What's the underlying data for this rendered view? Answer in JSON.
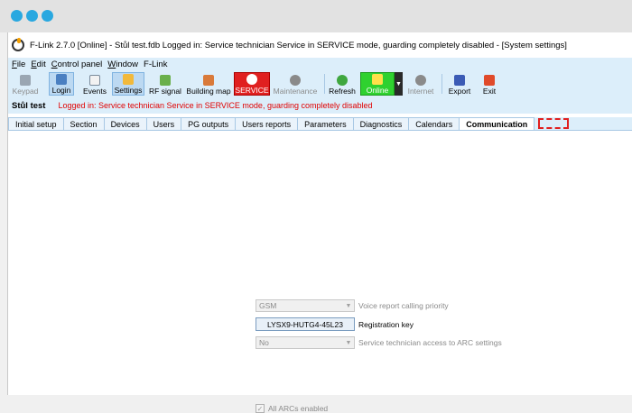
{
  "window": {
    "title": "F-Link 2.7.0 [Online] - Stůl test.fdb Logged in: Service technician Service in SERVICE mode, guarding completely disabled - [System settings]"
  },
  "menu": [
    {
      "accel": "F",
      "rest": "ile"
    },
    {
      "accel": "E",
      "rest": "dit"
    },
    {
      "accel": "C",
      "rest": "ontrol panel"
    },
    {
      "accel": "W",
      "rest": "indow"
    },
    {
      "accel": "",
      "rest": "F-Link"
    }
  ],
  "toolbar": {
    "keypad": "Keypad",
    "login": "Login",
    "events": "Events",
    "settings": "Settings",
    "rf_signal": "RF signal",
    "building_map": "Building map",
    "service": "SERVICE",
    "maintenance": "Maintenance",
    "refresh": "Refresh",
    "online": "Online",
    "internet": "Internet",
    "export": "Export",
    "exit": "Exit",
    "colors": {
      "service": "#e02020",
      "online": "#2fd12f"
    }
  },
  "status": {
    "device": "Stůl test",
    "message": "Logged in: Service technician Service in SERVICE mode, guarding completely disabled"
  },
  "tabs": [
    "Initial setup",
    "Section",
    "Devices",
    "Users",
    "PG outputs",
    "Users reports",
    "Parameters",
    "Diagnostics",
    "Calendars",
    "Communication"
  ],
  "active_tab": "Communication",
  "communication": {
    "voice_report_priority": {
      "value": "GSM",
      "label": "Voice report calling priority"
    },
    "registration_key": {
      "value": "LYSX9-HUTG4-45L23",
      "label": "Registration key"
    },
    "technician_arc_access": {
      "value": "No",
      "label": "Service technician access to ARC settings"
    },
    "all_arcs": {
      "checked": true,
      "label": "All ARCs enabled"
    }
  }
}
